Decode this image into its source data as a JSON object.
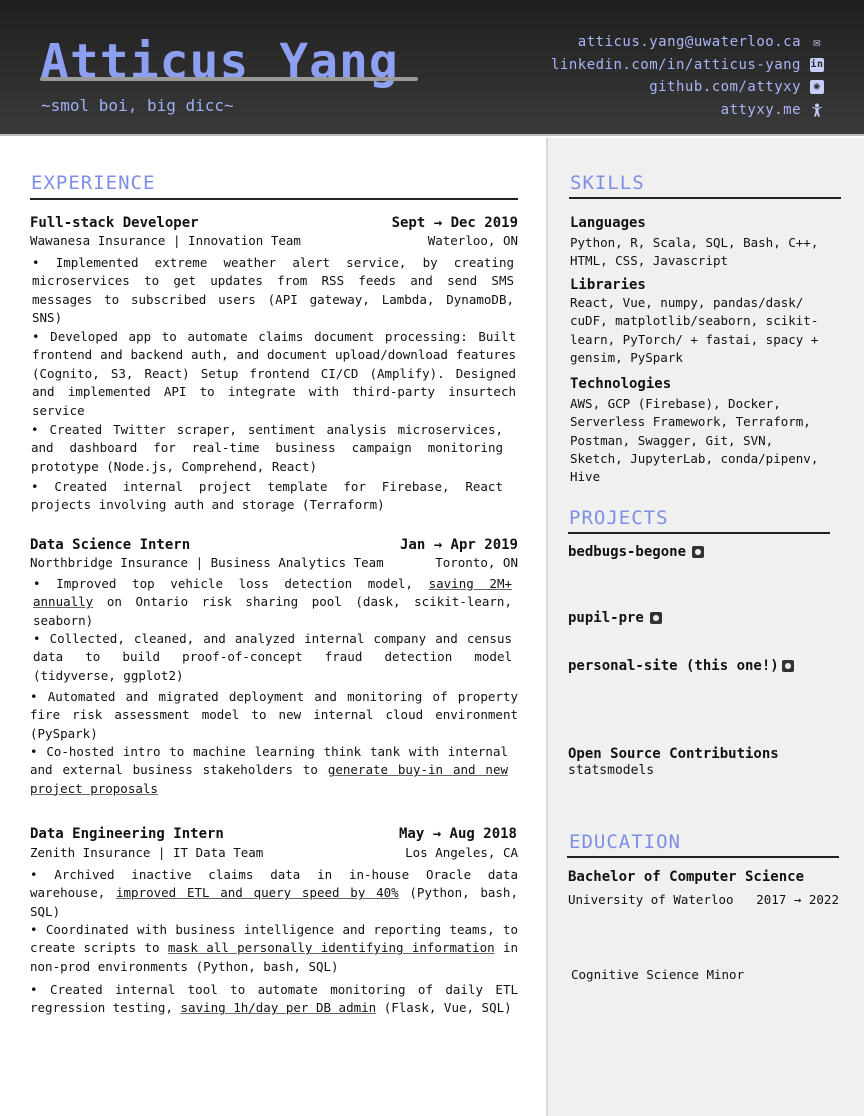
{
  "header": {
    "name": "Atticus Yang",
    "tagline": "~smol boi, big dicc~",
    "contacts": [
      {
        "text": "atticus.yang@uwaterloo.ca",
        "icon": "envelope-icon",
        "glyph": "✉"
      },
      {
        "text": "linkedin.com/in/atticus-yang",
        "icon": "linkedin-icon",
        "glyph": "in"
      },
      {
        "text": "github.com/attyxy",
        "icon": "github-icon",
        "glyph": "◉"
      },
      {
        "text": "attyxy.me",
        "icon": "person-icon",
        "glyph": "🯅"
      }
    ]
  },
  "experience": {
    "title": "EXPERIENCE",
    "jobs": [
      {
        "role": "Full-stack Developer",
        "dates": "Sept → Dec 2019",
        "company": "Wawanesa Insurance | Innovation Team",
        "location": "Waterloo, ON",
        "bullets": [
          "• Implemented extreme weather alert service, by creating microservices to get updates from RSS feeds and send SMS messages to subscribed users (API gateway, Lambda, DynamoDB, SNS)",
          "• Developed app to automate claims document processing: Built frontend and backend auth, and document upload/download features (Cognito, S3, React) Setup frontend CI/CD (Amplify). Designed and implemented API to integrate with third-party insurtech service",
          "• Created Twitter scraper, sentiment analysis microservices, and dashboard for real-time business campaign monitoring prototype (Node.js, Comprehend, React)",
          "• Created internal project template for Firebase, React projects involving auth and storage (Terraform)"
        ]
      },
      {
        "role": "Data Science Intern",
        "dates": "Jan → Apr 2019",
        "company": "Northbridge Insurance | Business Analytics Team",
        "location": "Toronto, ON",
        "bullets": [
          {
            "pre": "• Improved top vehicle loss detection model, ",
            "u": "saving 2M+ annually",
            "post": " on Ontario risk sharing pool (dask, scikit-learn, seaborn)"
          },
          "• Collected, cleaned, and analyzed internal company and census data to build proof-of-concept fraud detection model (tidyverse, ggplot2)",
          "• Automated and migrated deployment and monitoring of property fire risk assessment model to new internal cloud environment (PySpark)",
          {
            "pre": "• Co-hosted intro to machine learning think tank with internal and external business stakeholders to ",
            "u": "generate buy-in and new project proposals",
            "post": ""
          }
        ]
      },
      {
        "role": "Data Engineering Intern",
        "dates": "May → Aug 2018",
        "company": "Zenith Insurance | IT Data Team",
        "location": "Los Angeles, CA",
        "bullets": [
          {
            "pre": "• Archived inactive claims data in in-house Oracle data warehouse, ",
            "u": "improved ETL and query speed by 40%",
            "post": " (Python, bash, SQL)"
          },
          {
            "pre": "• Coordinated with business intelligence and reporting teams, to create scripts to ",
            "u": "mask all personally identifying information",
            "post": " in non-prod environments (Python, bash, SQL)"
          },
          {
            "pre": "• Created internal tool to automate monitoring of daily ETL regression testing, ",
            "u": "saving 1h/day per DB admin",
            "post": " (Flask, Vue, SQL)"
          }
        ]
      }
    ]
  },
  "skills": {
    "title": "SKILLS",
    "groups": [
      {
        "head": "Languages",
        "body": "Python, R, Scala, SQL, Bash, C++, HTML, CSS, Javascript"
      },
      {
        "head": "Libraries",
        "body": "React, Vue, numpy, pandas/dask/ cuDF, matplotlib/seaborn, scikit-learn, PyTorch/ + fastai, spacy + gensim, PySpark"
      },
      {
        "head": "Technologies",
        "body": "AWS, GCP (Firebase), Docker, Serverless Framework, Terraform, Postman, Swagger, Git, SVN, Sketch, JupyterLab, conda/pipenv, Hive"
      }
    ]
  },
  "projects": {
    "title": "PROJECTS",
    "items": [
      "bedbugs-begone",
      "pupil-pre",
      "personal-site (this one!)"
    ],
    "oss_head": "Open Source Contributions",
    "oss_body": "statsmodels"
  },
  "education": {
    "title": "EDUCATION",
    "degree": "Bachelor of Computer Science",
    "school": "University of Waterloo",
    "years": "2017 → 2022",
    "minor": "Cognitive Science Minor"
  },
  "colors": {
    "accent": "#7d8ee6",
    "header_bg": "#2a2a2a",
    "sidebar_bg": "#f0f0f0"
  }
}
